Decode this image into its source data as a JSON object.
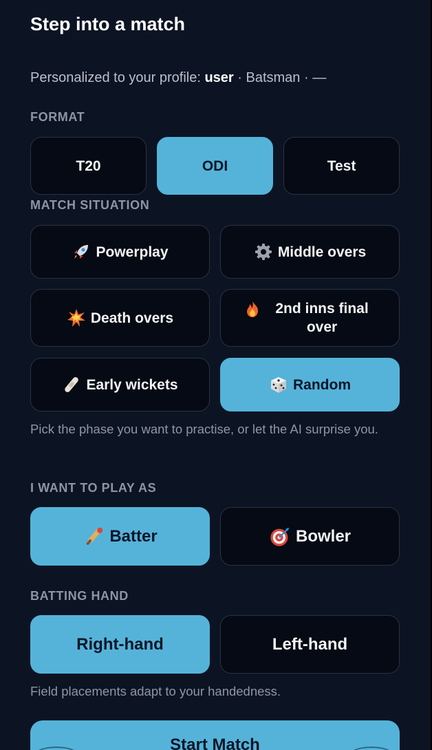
{
  "title": "Step into a match",
  "profile": {
    "prefix": "Personalized to your profile: ",
    "username": "user",
    "rest": " · Batsman · —"
  },
  "format": {
    "label": "FORMAT",
    "options": [
      {
        "label": "T20",
        "selected": false
      },
      {
        "label": "ODI",
        "selected": true
      },
      {
        "label": "Test",
        "selected": false
      }
    ]
  },
  "situation": {
    "label": "MATCH SITUATION",
    "options": [
      {
        "label": "Powerplay",
        "icon": "rocket-icon",
        "selected": false
      },
      {
        "label": "Middle overs",
        "icon": "gear-icon",
        "selected": false
      },
      {
        "label": "Death overs",
        "icon": "explosion-icon",
        "selected": false
      },
      {
        "label": "2nd inns final over",
        "icon": "fire-icon",
        "selected": false
      },
      {
        "label": "Early wickets",
        "icon": "bandage-icon",
        "selected": false
      },
      {
        "label": "Random",
        "icon": "dice-icon",
        "selected": true
      }
    ],
    "helper": "Pick the phase you want to practise, or let the AI surprise you."
  },
  "role": {
    "label": "I WANT TO PLAY AS",
    "options": [
      {
        "label": "Batter",
        "icon": "cricket-bat-icon",
        "selected": true
      },
      {
        "label": "Bowler",
        "icon": "target-icon",
        "selected": false
      }
    ]
  },
  "hand": {
    "label": "BATTING HAND",
    "options": [
      {
        "label": "Right-hand",
        "selected": true
      },
      {
        "label": "Left-hand",
        "selected": false
      }
    ],
    "helper": "Field placements adapt to your handedness."
  },
  "start_label": "Start Match",
  "colors": {
    "background": "#0c1423",
    "accent": "#55b3d9",
    "chip": "#050a14"
  }
}
